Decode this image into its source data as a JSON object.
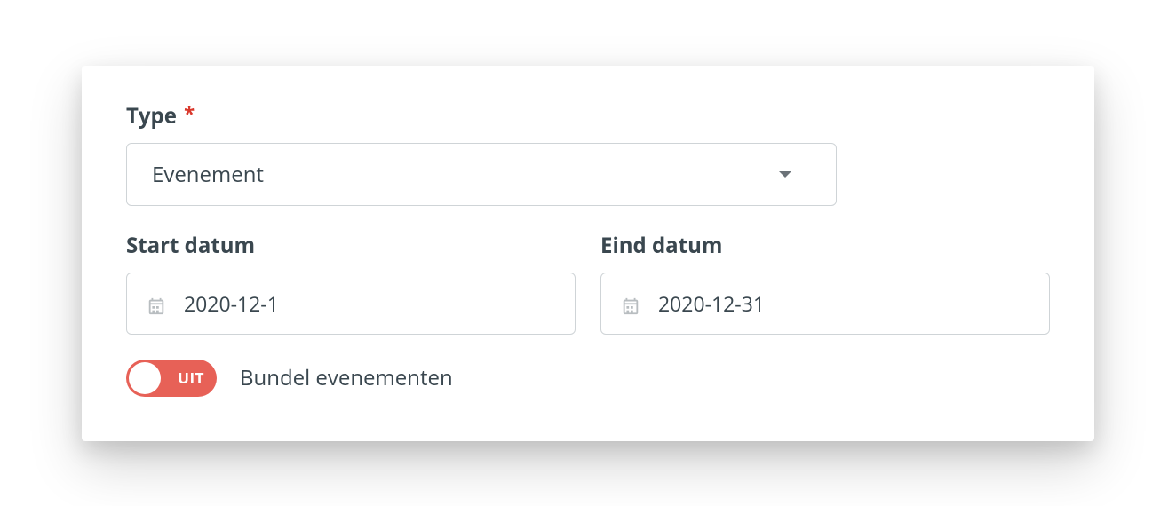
{
  "form": {
    "type_label": "Type",
    "type_required_marker": "*",
    "type_value": "Evenement",
    "start_date_label": "Start datum",
    "start_date_value": "2020-12-1",
    "end_date_label": "Eind datum",
    "end_date_value": "2020-12-31",
    "bundle_toggle_state_text": "UIT",
    "bundle_toggle_label": "Bundel evenementen"
  }
}
